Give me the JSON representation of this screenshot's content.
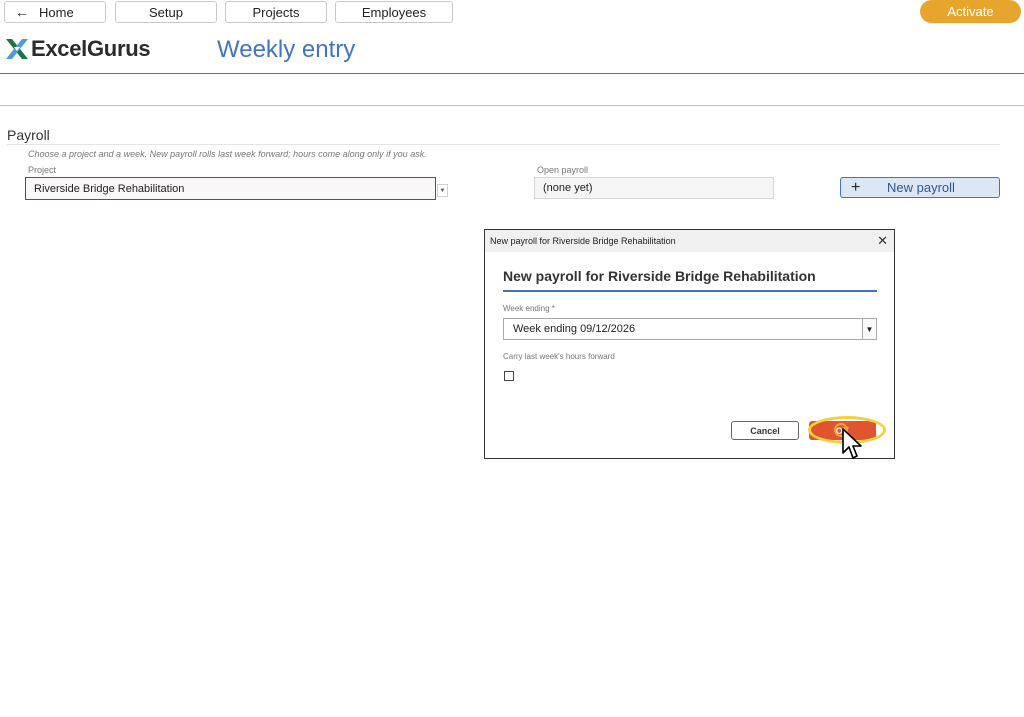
{
  "nav": {
    "home": "Home",
    "setup": "Setup",
    "projects": "Projects",
    "employees": "Employees",
    "activate": "Activate"
  },
  "logo": {
    "text": "ExcelGurus"
  },
  "header": {
    "title": "Weekly entry"
  },
  "section": {
    "title": "Payroll",
    "hint": "Choose a project and a week. New payroll rolls last week forward; hours come along only if you ask."
  },
  "project": {
    "label": "Project",
    "value": "Riverside Bridge Rehabilitation"
  },
  "open_payroll": {
    "label": "Open payroll",
    "value": "(none yet)"
  },
  "new_payroll_button": "New payroll",
  "dialog": {
    "window_title": "New payroll for Riverside Bridge Rehabilitation",
    "heading": "New payroll for Riverside Bridge Rehabilitation",
    "week_label": "Week ending *",
    "week_value": "Week ending 09/12/2026",
    "carry_label": "Carry last week's hours forward",
    "carry_checked": false,
    "cancel": "Cancel",
    "ok": "OK"
  },
  "colors": {
    "accent": "#4472c4",
    "activate": "#e6a52c",
    "ok_button": "#e0542f",
    "highlight": "#f3d03e",
    "logo_green": "#217346"
  }
}
